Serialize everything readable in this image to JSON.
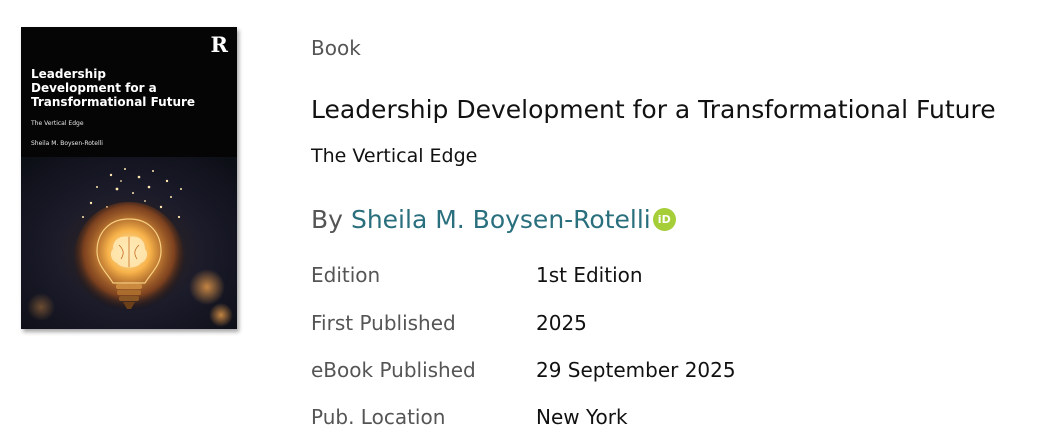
{
  "cover": {
    "logo": "R",
    "title": "Leadership\nDevelopment for a\nTransformational Future",
    "subtitle": "The Vertical Edge",
    "author": "Sheila M. Boysen-Rotelli"
  },
  "book": {
    "type_label": "Book",
    "title": "Leadership Development for a Transformational Future",
    "subtitle": "The Vertical Edge",
    "by_prefix": "By",
    "author": "Sheila M. Boysen-Rotelli",
    "orcid_label": "iD"
  },
  "details": [
    {
      "label": "Edition",
      "value": "1st Edition"
    },
    {
      "label": "First Published",
      "value": "2025"
    },
    {
      "label": "eBook Published",
      "value": "29 September 2025"
    },
    {
      "label": "Pub. Location",
      "value": "New York"
    }
  ],
  "colors": {
    "author_link": "#2a6f7d",
    "orcid_badge": "#a6ce39"
  },
  "icons": {
    "orcid": "orcid-icon",
    "bulb": "lightbulb-brain-icon"
  }
}
